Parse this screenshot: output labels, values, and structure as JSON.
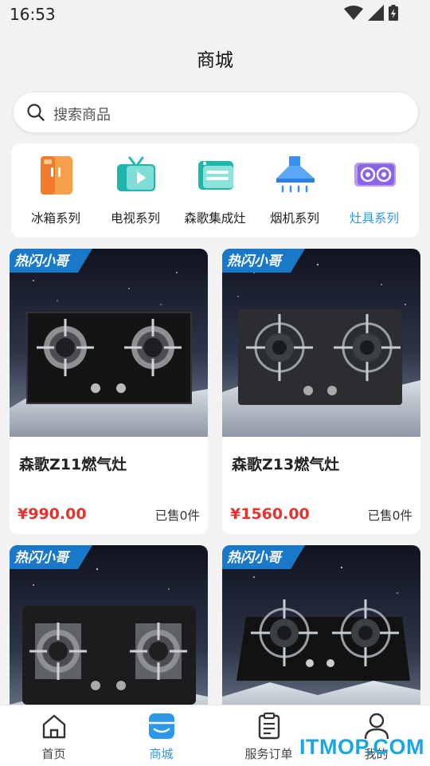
{
  "status_bar": {
    "time": "16:53"
  },
  "header": {
    "title": "商城"
  },
  "search": {
    "placeholder": "搜索商品"
  },
  "categories": [
    {
      "label": "冰箱系列",
      "icon": "fridge-icon",
      "active": false
    },
    {
      "label": "电视系列",
      "icon": "tv-icon",
      "active": false
    },
    {
      "label": "森歌集成灶",
      "icon": "integrated-stove-icon",
      "active": false
    },
    {
      "label": "烟机系列",
      "icon": "range-hood-icon",
      "active": false
    },
    {
      "label": "灶具系列",
      "icon": "cooktop-icon",
      "active": true
    }
  ],
  "products": [
    {
      "badge": "热闪小哥",
      "name": "森歌Z11燃气灶",
      "price": "¥990.00",
      "sold": "已售0件"
    },
    {
      "badge": "热闪小哥",
      "name": "森歌Z13燃气灶",
      "price": "¥1560.00",
      "sold": "已售0件"
    },
    {
      "badge": "热闪小哥",
      "name": "",
      "price": "",
      "sold": ""
    },
    {
      "badge": "热闪小哥",
      "name": "",
      "price": "",
      "sold": ""
    }
  ],
  "bottom_nav": [
    {
      "label": "首页",
      "icon": "home-icon",
      "active": false
    },
    {
      "label": "商城",
      "icon": "store-icon",
      "active": true
    },
    {
      "label": "服务订单",
      "icon": "clipboard-icon",
      "active": false
    },
    {
      "label": "我的",
      "icon": "user-icon",
      "active": false
    }
  ],
  "watermark": "ITMOP.COM",
  "colors": {
    "accent": "#2d97e8",
    "price": "#e8332d",
    "background": "#f2f2f2"
  }
}
